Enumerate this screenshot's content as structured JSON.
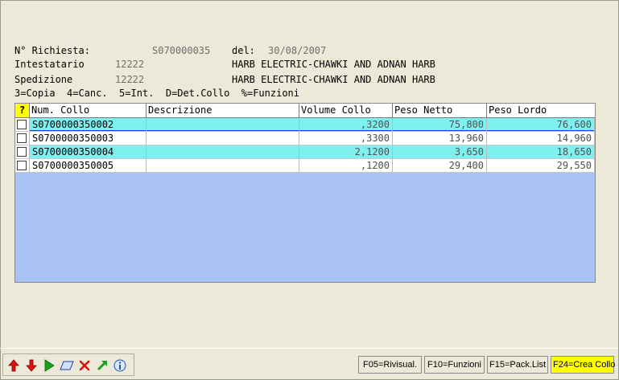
{
  "header": {
    "richiesta_label": "N° Richiesta:",
    "richiesta_value": "S070000035",
    "del_label": "del:",
    "del_value": "30/08/2007",
    "intestatario_label": "Intestatario",
    "intestatario_code": "12222",
    "intestatario_name": "HARB ELECTRIC-CHAWKI AND ADNAN HARB",
    "spedizione_label": "Spedizione",
    "spedizione_code": "12222",
    "spedizione_name": "HARB ELECTRIC-CHAWKI AND ADNAN HARB",
    "legend": "3=Copia  4=Canc.  5=Int.  D=Det.Collo  %=Funzioni"
  },
  "grid": {
    "help_glyph": "?",
    "columns": [
      "Num. Collo",
      "Descrizione",
      "Volume Collo",
      "Peso Netto",
      "Peso Lordo"
    ],
    "rows": [
      {
        "num": "S0700000350002",
        "descr": "",
        "volume": ",3200",
        "netto": "75,800",
        "lordo": "76,600",
        "highlight": true,
        "selected": true
      },
      {
        "num": "S0700000350003",
        "descr": "",
        "volume": ",3300",
        "netto": "13,960",
        "lordo": "14,960",
        "highlight": false,
        "selected": false
      },
      {
        "num": "S0700000350004",
        "descr": "",
        "volume": "2,1200",
        "netto": "3,650",
        "lordo": "18,650",
        "highlight": true,
        "selected": false
      },
      {
        "num": "S0700000350005",
        "descr": "",
        "volume": ",1200",
        "netto": "29,400",
        "lordo": "29,550",
        "highlight": false,
        "selected": false
      }
    ],
    "colors": {
      "highlight": "#7ff0f0",
      "normal": "#ffffff",
      "empty_area": "#a9c2f5"
    }
  },
  "toolbar": {
    "icons": [
      "arrow-up-icon",
      "arrow-down-icon",
      "play-icon",
      "eraser-icon",
      "delete-icon",
      "refresh-icon",
      "info-icon"
    ]
  },
  "function_keys": {
    "f05": "F05=Rivisual.",
    "f10": "F10=Funzioni",
    "f15": "F15=Pack.List",
    "f24": "F24=Crea Collo"
  }
}
